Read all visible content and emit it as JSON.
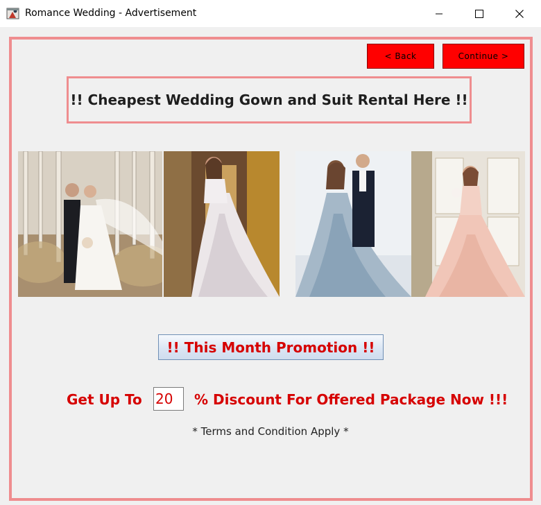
{
  "window": {
    "title": "Romance Wedding - Advertisement",
    "icons": [
      "app-icon",
      "minimize-icon",
      "maximize-icon",
      "close-icon"
    ]
  },
  "nav": {
    "back_label": "< Back",
    "continue_label": "Continue >"
  },
  "headline": "!! Cheapest Wedding Gown and Suit Rental Here !!",
  "photos": [
    {
      "name": "couple-forest-photo"
    },
    {
      "name": "lace-gown-photo"
    },
    {
      "name": "blue-gown-couple-photo"
    },
    {
      "name": "pink-gown-photo"
    }
  ],
  "promo_button": "!! This Month Promotion !!",
  "discount": {
    "prefix": "Get Up To",
    "value": "20",
    "suffix": "% Discount For Offered Package Now !!!"
  },
  "terms": "* Terms and Condition Apply *",
  "colors": {
    "frame_border": "#ef8d8f",
    "nav_button": "#ff0000",
    "promo_text": "#d60000",
    "background": "#f0f0f0"
  }
}
